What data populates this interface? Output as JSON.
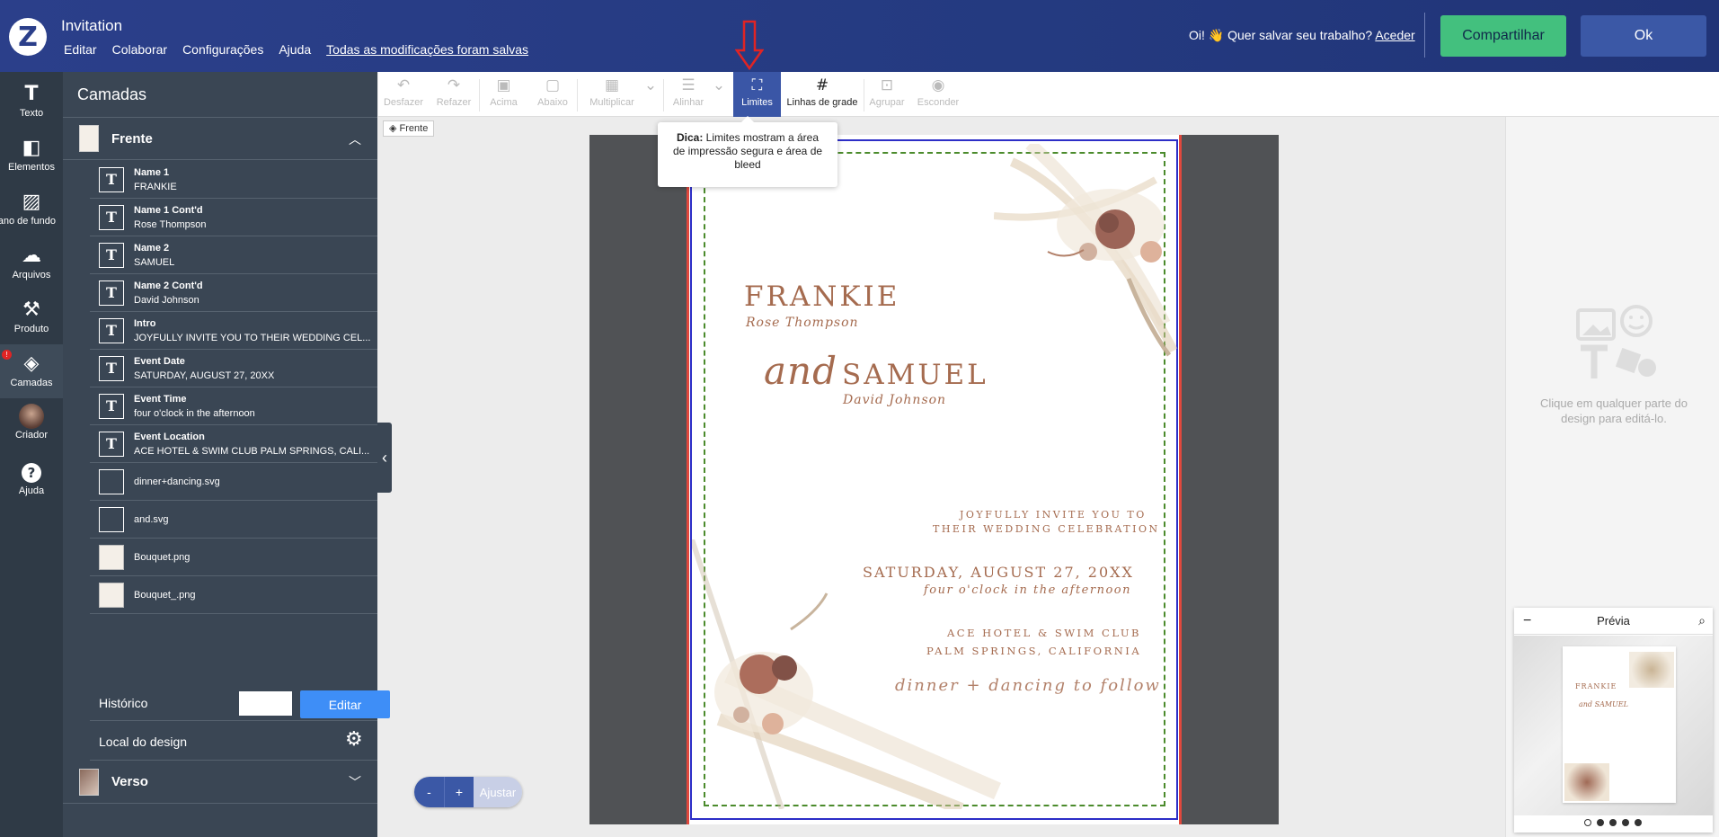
{
  "header": {
    "title": "Invitation",
    "menu": [
      "Editar",
      "Colaborar",
      "Configurações",
      "Ajuda"
    ],
    "save_status": "Todas as modificações foram salvas",
    "greeting": "Oi! 👋 Quer salvar seu trabalho?",
    "login_link": "Aceder",
    "share_label": "Compartilhar",
    "ok_label": "Ok"
  },
  "rail": [
    {
      "label": "Texto",
      "icon": "text-icon"
    },
    {
      "label": "Elementos",
      "icon": "elements-icon"
    },
    {
      "label": "Plano de fundo",
      "icon": "background-icon"
    },
    {
      "label": "Arquivos",
      "icon": "upload-icon"
    },
    {
      "label": "Produto",
      "icon": "product-icon"
    },
    {
      "label": "Camadas",
      "icon": "layers-icon",
      "badge": "!"
    },
    {
      "label": "Criador",
      "icon": "creator-avatar"
    },
    {
      "label": "Ajuda",
      "icon": "help-icon"
    }
  ],
  "layers_panel": {
    "title": "Camadas",
    "front_label": "Frente",
    "back_label": "Verso",
    "layers": [
      {
        "name": "Name 1",
        "value": "FRANKIE",
        "type": "text"
      },
      {
        "name": "Name 1 Cont'd",
        "value": "Rose Thompson",
        "type": "text"
      },
      {
        "name": "Name 2",
        "value": "SAMUEL",
        "type": "text"
      },
      {
        "name": "Name 2 Cont'd",
        "value": "David Johnson",
        "type": "text"
      },
      {
        "name": "Intro",
        "value": "JOYFULLY INVITE YOU TO THEIR WEDDING CEL...",
        "type": "text"
      },
      {
        "name": "Event Date",
        "value": "SATURDAY, AUGUST 27, 20XX",
        "type": "text"
      },
      {
        "name": "Event Time",
        "value": "four o'clock in the afternoon",
        "type": "text"
      },
      {
        "name": "Event Location",
        "value": "ACE HOTEL & SWIM CLUB PALM SPRINGS, CALI...",
        "type": "text"
      },
      {
        "name": "dinner+dancing.svg",
        "value": "",
        "type": "blank"
      },
      {
        "name": "and.svg",
        "value": "",
        "type": "blank"
      },
      {
        "name": "Bouquet.png",
        "value": "",
        "type": "image"
      },
      {
        "name": "Bouquet_.png",
        "value": "",
        "type": "image"
      }
    ],
    "history_label": "Histórico",
    "edit_label": "Editar",
    "design_location_label": "Local do design"
  },
  "toolbar": [
    {
      "label": "Desfazer",
      "icon": "↶",
      "state": "off"
    },
    {
      "label": "Refazer",
      "icon": "↷",
      "state": "off"
    },
    {
      "label": "Acima",
      "icon": "▣",
      "state": "off"
    },
    {
      "label": "Abaixo",
      "icon": "▢",
      "state": "off"
    },
    {
      "label": "Multiplicar",
      "icon": "▦",
      "state": "off"
    },
    {
      "label": "Alinhar",
      "icon": "☰",
      "state": "off"
    },
    {
      "label": "Limites",
      "icon": "⛶",
      "state": "active"
    },
    {
      "label": "Linhas de grade",
      "icon": "#",
      "state": "on"
    },
    {
      "label": "Agrupar",
      "icon": "⊡",
      "state": "off"
    },
    {
      "label": "Esconder",
      "icon": "◉",
      "state": "off"
    }
  ],
  "side_tag": "Frente",
  "tooltip": {
    "bold": "Dica:",
    "text": " Limites mostram a área de impressão segura e área de bleed"
  },
  "invite": {
    "name1": "FRANKIE",
    "name1_sub": "Rose Thompson",
    "and": "and",
    "name2": "SAMUEL",
    "name2_sub": "David Johnson",
    "intro1": "JOYFULLY INVITE YOU TO",
    "intro2": "THEIR WEDDING CELEBRATION",
    "date": "SATURDAY, AUGUST 27, 20XX",
    "time": "four o'clock in the afternoon",
    "loc1": "ACE HOTEL & SWIM CLUB",
    "loc2": "PALM SPRINGS, CALIFORNIA",
    "footer": "dinner + dancing to follow"
  },
  "zoom": {
    "minus": "-",
    "plus": "+",
    "fit": "Ajustar"
  },
  "right_pane": {
    "hint": "Clique em qualquer parte do design para editá-lo."
  },
  "preview": {
    "title": "Prévia",
    "min": "−"
  },
  "colors": {
    "accent": "#3b58a6",
    "share": "#43c07e",
    "ink": "#a56b4f",
    "bleed": "#e0483d",
    "safe": "#2d2ec7",
    "trim": "#4b8b2c"
  }
}
